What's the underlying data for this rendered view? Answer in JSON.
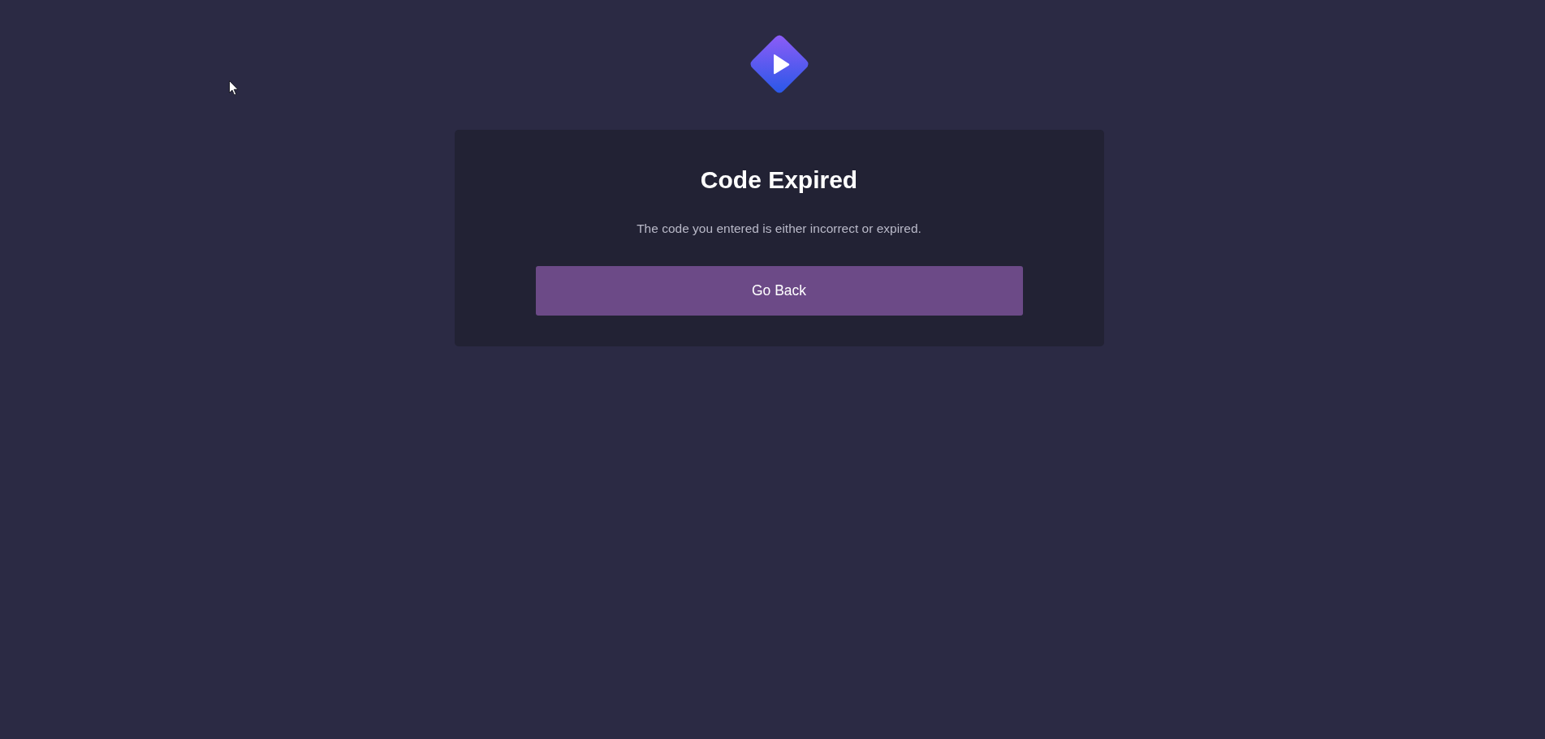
{
  "card": {
    "title": "Code Expired",
    "message": "The code you entered is either incorrect or expired.",
    "button": "Go Back"
  }
}
